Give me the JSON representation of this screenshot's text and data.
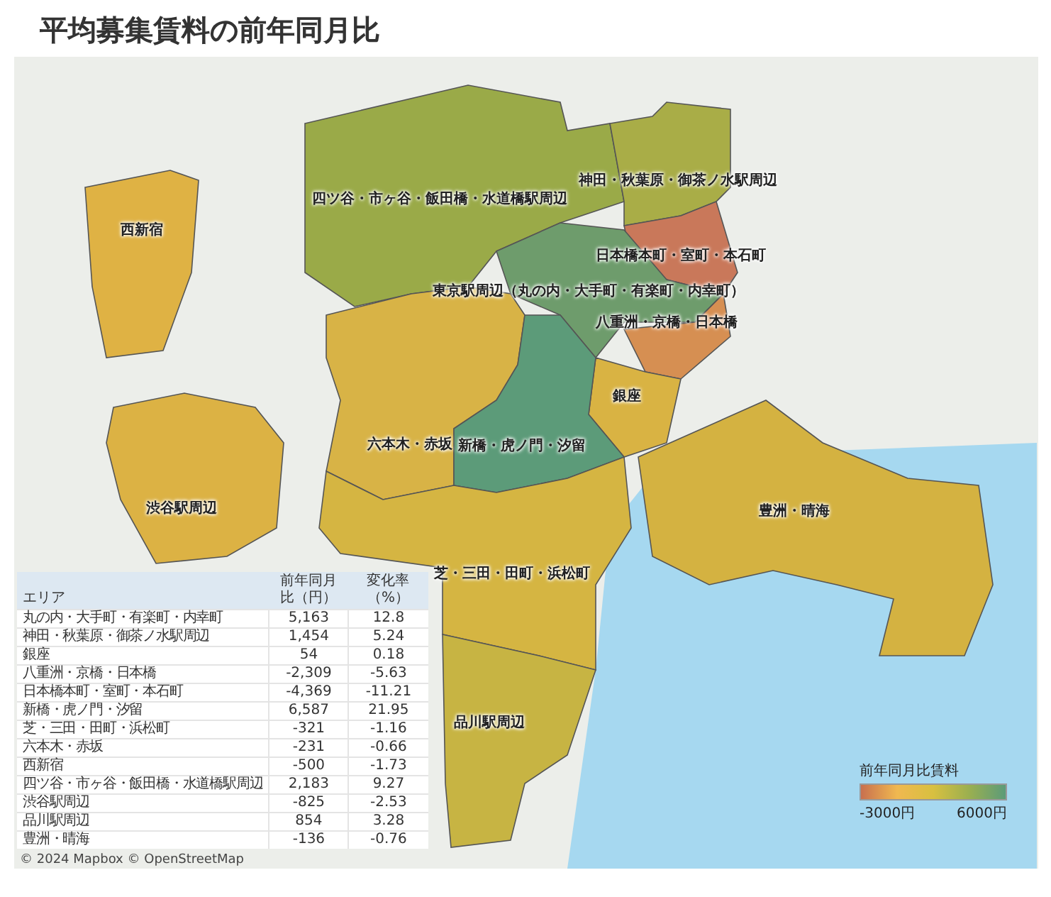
{
  "title": "平均募集賃料の前年同月比",
  "regions": [
    {
      "label": "西新宿",
      "color": "#dfb244"
    },
    {
      "label": "四ツ谷・市ヶ谷・飯田橋・水道橋駅周辺",
      "color": "#9aaa48"
    },
    {
      "label": "神田・秋葉原・御茶ノ水駅周辺",
      "color": "#a9ad47"
    },
    {
      "label": "日本橋本町・室町・本石町",
      "color": "#c9785a"
    },
    {
      "label": "東京駅周辺（丸の内・大手町・有楽町・内幸町）",
      "color": "#6e9c6c"
    },
    {
      "label": "八重洲・京橋・日本橋",
      "color": "#d68f52"
    },
    {
      "label": "銀座",
      "color": "#d9b343"
    },
    {
      "label": "六本木・赤坂",
      "color": "#d8b346"
    },
    {
      "label": "新橋・虎ノ門・汐留",
      "color": "#5c9b79"
    },
    {
      "label": "渋谷駅周辺",
      "color": "#dcb244"
    },
    {
      "label": "芝・三田・田町・浜松町",
      "color": "#d5b542"
    },
    {
      "label": "品川駅周辺",
      "color": "#c7b443"
    },
    {
      "label": "豊洲・晴海",
      "color": "#d4b241"
    }
  ],
  "table": {
    "columns": [
      "エリア",
      "前年同月比（円）",
      "変化率（%）"
    ],
    "rows": [
      [
        "丸の内・大手町・有楽町・内幸町",
        "5,163",
        "12.8"
      ],
      [
        "神田・秋葉原・御茶ノ水駅周辺",
        "1,454",
        "5.24"
      ],
      [
        "銀座",
        "54",
        "0.18"
      ],
      [
        "八重洲・京橋・日本橋",
        "-2,309",
        "-5.63"
      ],
      [
        "日本橋本町・室町・本石町",
        "-4,369",
        "-11.21"
      ],
      [
        "新橋・虎ノ門・汐留",
        "6,587",
        "21.95"
      ],
      [
        "芝・三田・田町・浜松町",
        "-321",
        "-1.16"
      ],
      [
        "六本木・赤坂",
        "-231",
        "-0.66"
      ],
      [
        "西新宿",
        "-500",
        "-1.73"
      ],
      [
        "四ツ谷・市ヶ谷・飯田橋・水道橋駅周辺",
        "2,183",
        "9.27"
      ],
      [
        "渋谷駅周辺",
        "-825",
        "-2.53"
      ],
      [
        "品川駅周辺",
        "854",
        "3.28"
      ],
      [
        "豊洲・晴海",
        "-136",
        "-0.76"
      ]
    ]
  },
  "legend": {
    "title": "前年同月比賃料",
    "min_label": "-3000円",
    "max_label": "6000円"
  },
  "attribution": "© 2024 Mapbox © OpenStreetMap"
}
